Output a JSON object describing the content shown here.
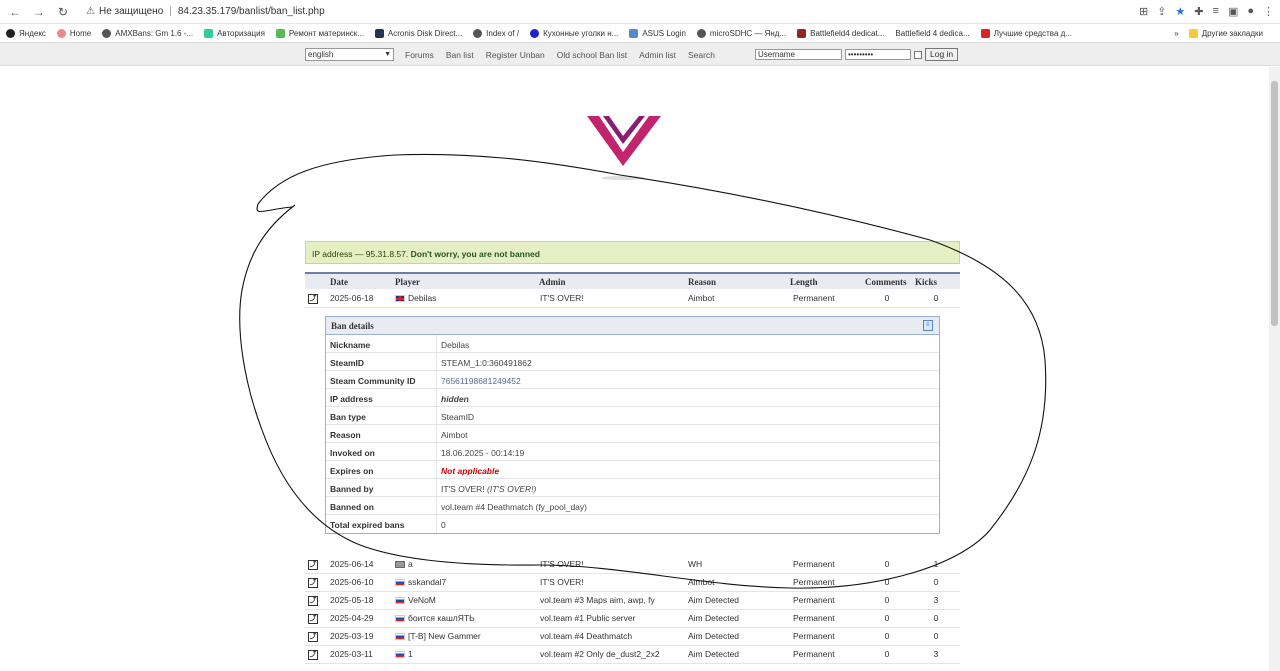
{
  "browser": {
    "url_warning": "Не защищено",
    "url": "84.23.35.179/banlist/ban_list.php"
  },
  "bookmarks": {
    "items": [
      "Яндекс",
      "Home",
      "AMXBans: Gm 1.6 -...",
      "Авторизация",
      "Ремонт материнск...",
      "Acronis Disk Direct...",
      "Index of /",
      "Кухонные уголки н...",
      "ASUS Login",
      "microSDHC — Янд...",
      "Battlefield4 dedicat...",
      "Battlefield 4 dedica...",
      "Лучшие средства д..."
    ],
    "more": "»",
    "other": "Другие закладки"
  },
  "topnav": {
    "language": "english",
    "links": [
      "Forums",
      "Ban list",
      "Register Unban",
      "Old school Ban list",
      "Admin list",
      "Search"
    ],
    "username_placeholder": "Username",
    "password_value": "•••••••••",
    "login_button": "Log in"
  },
  "notice": {
    "text": "IP address — 95.31.8.57. ",
    "strong": "Don't worry, you are not banned"
  },
  "table": {
    "headers": [
      "Date",
      "Player",
      "Admin",
      "Reason",
      "Length",
      "Comments",
      "Kicks"
    ],
    "first_row": {
      "date": "2025-06-18",
      "player": "Debilas",
      "admin": "IT'S OVER!",
      "reason": "Aimbot",
      "length": "Permanent",
      "comments": "0",
      "kicks": "0"
    },
    "rows": [
      {
        "date": "2025-06-14",
        "player": "a",
        "admin": "IT'S OVER!",
        "reason": "WH",
        "length": "Permanent",
        "comments": "0",
        "kicks": "1"
      },
      {
        "date": "2025-06-10",
        "player": "sskandal7",
        "admin": "IT'S OVER!",
        "reason": "Aimbot",
        "length": "Permanent",
        "comments": "0",
        "kicks": "0"
      },
      {
        "date": "2025-05-18",
        "player": "VeNoM",
        "admin": "vol.team #3 Maps aim, awp, fy",
        "reason": "Aim Detected",
        "length": "Permanent",
        "comments": "0",
        "kicks": "3"
      },
      {
        "date": "2025-04-29",
        "player": "боится кашлЯТЬ",
        "admin": "vol.team #1 Public server",
        "reason": "Aim Detected",
        "length": "Permanent",
        "comments": "0",
        "kicks": "0"
      },
      {
        "date": "2025-03-19",
        "player": "[T-B] New Gammer",
        "admin": "vol.team #4 Deathmatch",
        "reason": "Aim Detected",
        "length": "Permanent",
        "comments": "0",
        "kicks": "0"
      },
      {
        "date": "2025-03-11",
        "player": "1",
        "admin": "vol.team #2 Only de_dust2_2x2",
        "reason": "Aim Detected",
        "length": "Permanent",
        "comments": "0",
        "kicks": "3"
      }
    ]
  },
  "details": {
    "title": "Ban details",
    "rows": [
      {
        "label": "Nickname",
        "value": "Debilas"
      },
      {
        "label": "SteamID",
        "value": "STEAM_1:0:360491862"
      },
      {
        "label": "Steam Community ID",
        "value": "76561198681249452"
      },
      {
        "label": "IP address",
        "value": "hidden"
      },
      {
        "label": "Ban type",
        "value": "SteamID"
      },
      {
        "label": "Reason",
        "value": "Aimbot"
      },
      {
        "label": "Invoked on",
        "value": "18.06.2025 - 00:14:19"
      },
      {
        "label": "Expires on",
        "value": "Not applicable"
      },
      {
        "label": "Banned by",
        "value": "IT'S OVER!",
        "extra": "(IT'S OVER!)"
      },
      {
        "label": "Banned on",
        "value": "vol.team #4 Deathmatch (fy_pool_day)"
      },
      {
        "label": "Total expired bans",
        "value": "0"
      }
    ]
  }
}
